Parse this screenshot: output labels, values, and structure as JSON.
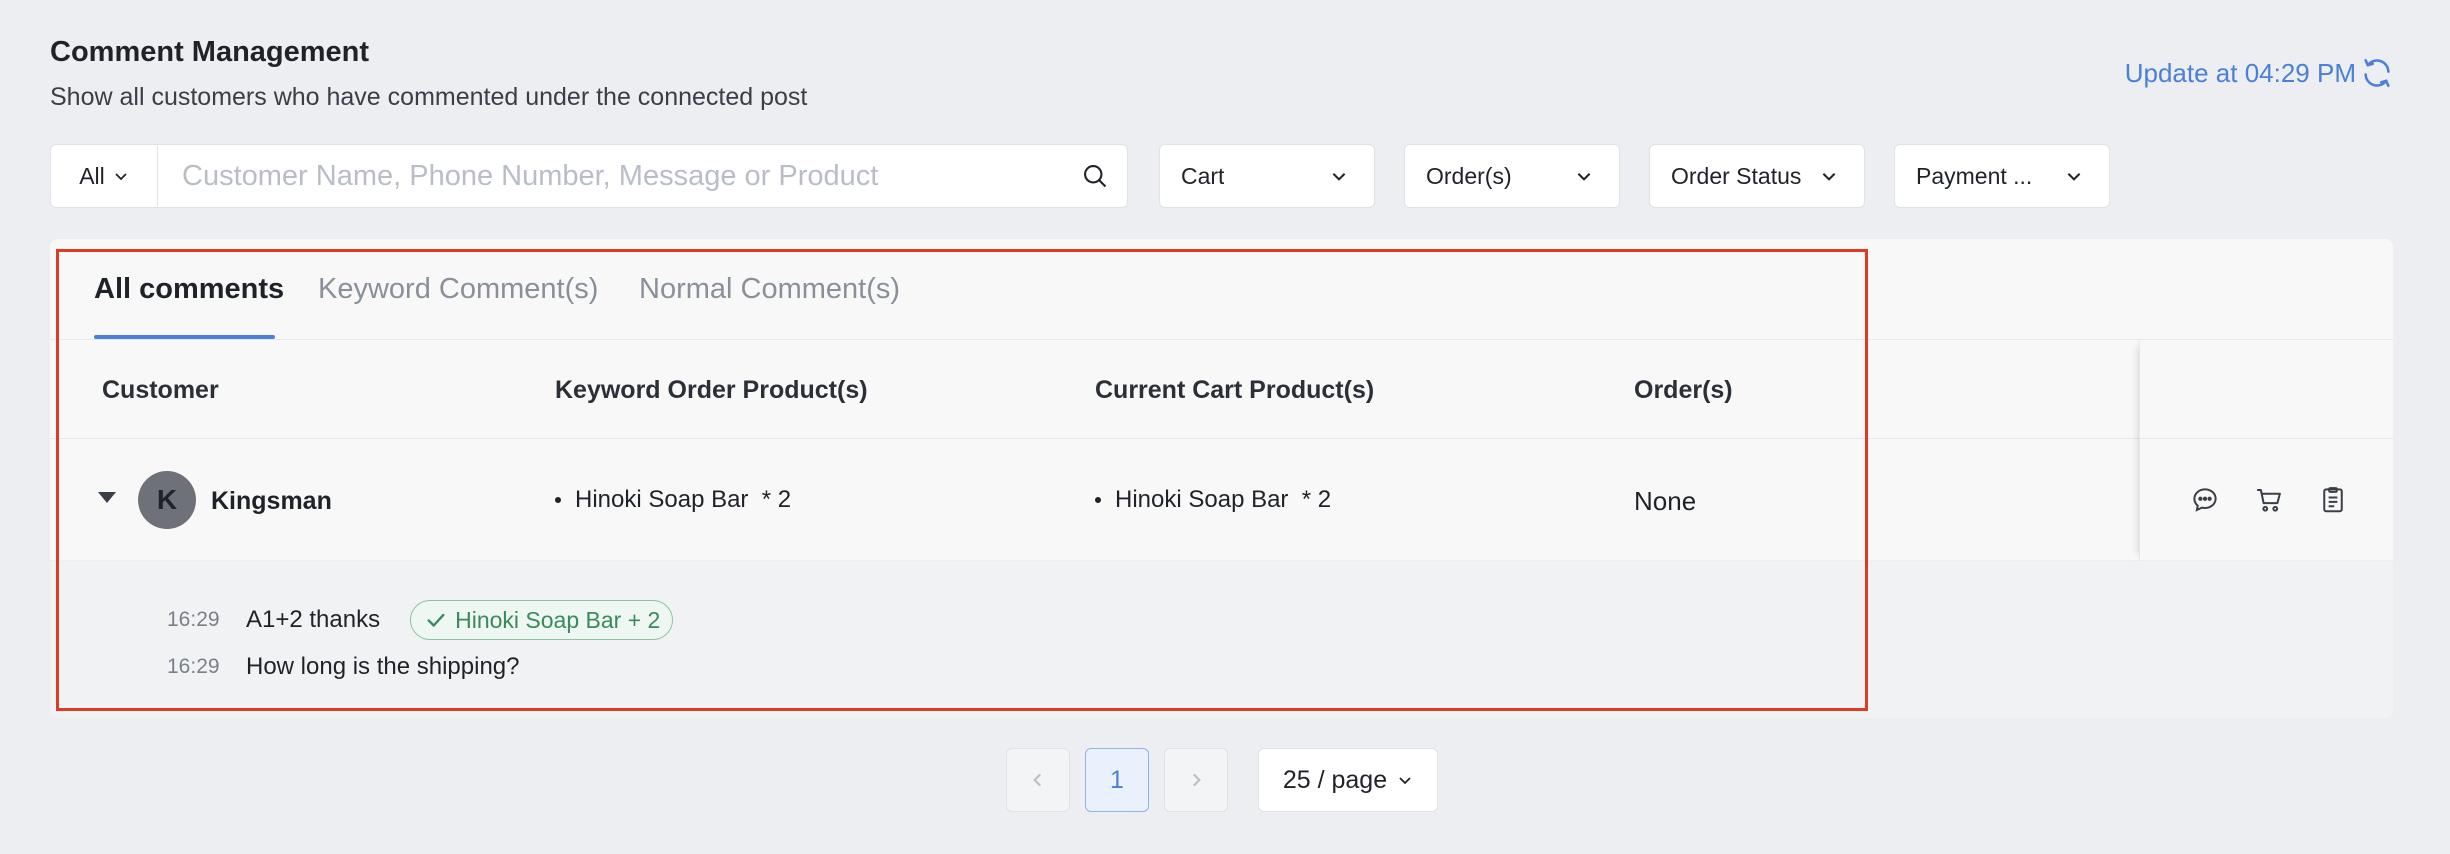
{
  "header": {
    "title": "Comment Management",
    "subtitle": "Show all customers who have commented under the connected post",
    "update_label": "Update at 04:29 PM"
  },
  "filters": {
    "scope": "All",
    "search_placeholder": "Customer Name, Phone Number, Message or Product",
    "cart": "Cart",
    "orders": "Order(s)",
    "order_status": "Order Status",
    "payment": "Payment ..."
  },
  "tabs": [
    {
      "label": "All comments",
      "active": true
    },
    {
      "label": "Keyword Comment(s)",
      "active": false
    },
    {
      "label": "Normal Comment(s)",
      "active": false
    }
  ],
  "table": {
    "columns": [
      "Customer",
      "Keyword Order Product(s)",
      "Current Cart Product(s)",
      "Order(s)"
    ],
    "row": {
      "avatar_letter": "K",
      "customer": "Kingsman",
      "keyword_product": "Hinoki Soap Bar  * 2",
      "cart_product": "Hinoki Soap Bar  * 2",
      "orders": "None"
    },
    "messages": [
      {
        "time": "16:29",
        "text": "A1+2 thanks",
        "tag": "Hinoki Soap Bar + 2"
      },
      {
        "time": "16:29",
        "text": "How long is the shipping?"
      }
    ]
  },
  "pagination": {
    "current_page": "1",
    "page_size": "25 / page"
  },
  "colors": {
    "accent": "#4a80d8",
    "highlight_border": "#df3b24",
    "tag_green": "#3a8a5c"
  }
}
